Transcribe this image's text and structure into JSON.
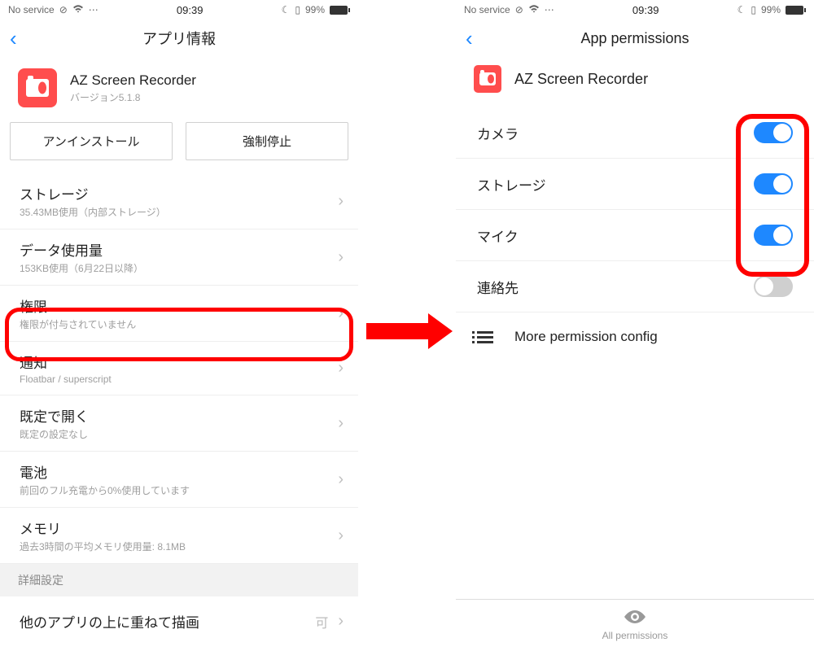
{
  "statusbar": {
    "carrier": "No service",
    "time": "09:39",
    "battery_pct": "99%"
  },
  "left": {
    "title": "アプリ情報",
    "app_name": "AZ Screen Recorder",
    "app_version": "バージョン5.1.8",
    "btn_uninstall": "アンインストール",
    "btn_force_stop": "強制停止",
    "items": [
      {
        "primary": "ストレージ",
        "secondary": "35.43MB使用（内部ストレージ）"
      },
      {
        "primary": "データ使用量",
        "secondary": "153KB使用（6月22日以降）"
      },
      {
        "primary": "権限",
        "secondary": "権限が付与されていません"
      },
      {
        "primary": "通知",
        "secondary": "Floatbar / superscript"
      },
      {
        "primary": "既定で開く",
        "secondary": "既定の設定なし"
      },
      {
        "primary": "電池",
        "secondary": "前回のフル充電から0%使用しています"
      },
      {
        "primary": "メモリ",
        "secondary": "過去3時間の平均メモリ使用量: 8.1MB"
      }
    ],
    "section_advanced": "詳細設定",
    "overlay_primary": "他のアプリの上に重ねて描画",
    "overlay_value": "可"
  },
  "right": {
    "title": "App permissions",
    "app_name": "AZ Screen Recorder",
    "permissions": [
      {
        "label": "カメラ",
        "on": true
      },
      {
        "label": "ストレージ",
        "on": true
      },
      {
        "label": "マイク",
        "on": true
      },
      {
        "label": "連絡先",
        "on": false
      }
    ],
    "more_perm": "More permission config",
    "bottom_label": "All permissions"
  }
}
